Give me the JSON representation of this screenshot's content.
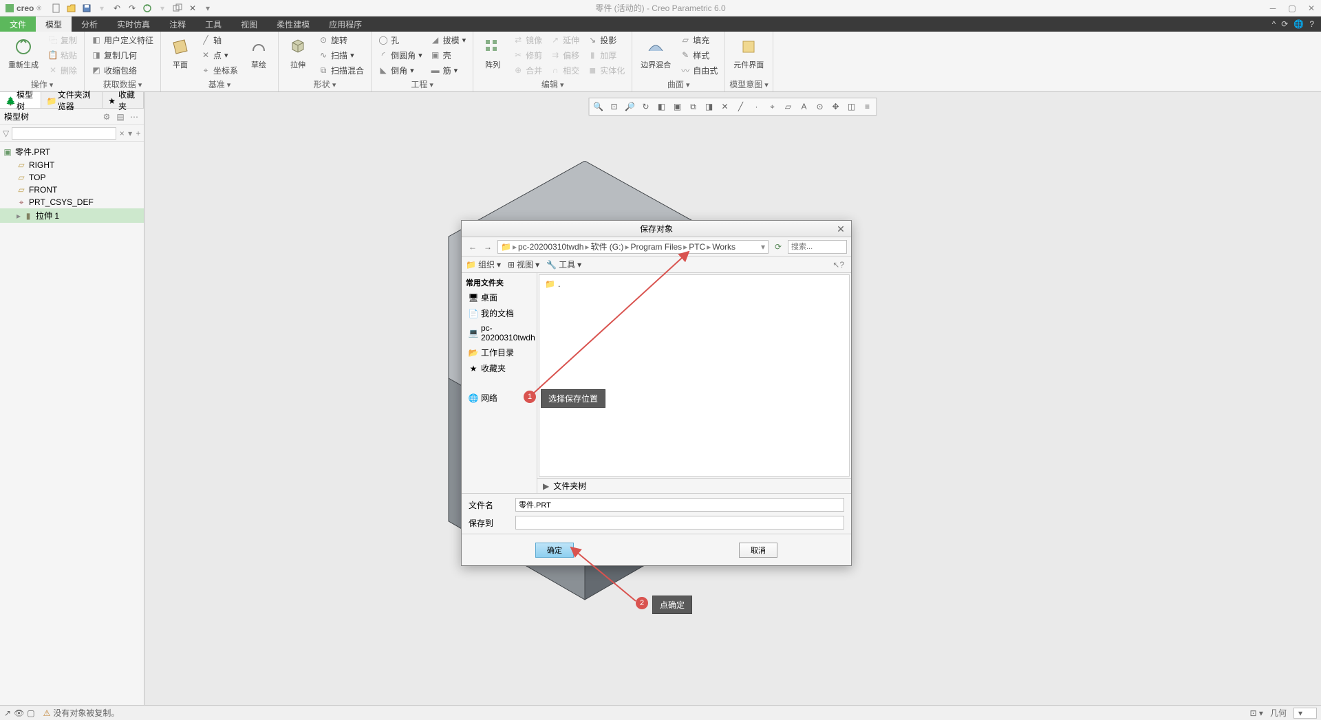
{
  "titlebar": {
    "logo_text": "creo",
    "title": "零件 (活动的) - Creo Parametric 6.0"
  },
  "menu_tabs": {
    "file": "文件",
    "model": "模型",
    "analysis": "分析",
    "realtime": "实时仿真",
    "annotate": "注释",
    "tools": "工具",
    "view": "视图",
    "flex": "柔性建模",
    "app": "应用程序"
  },
  "ribbon": {
    "regen": {
      "big": "重新生成",
      "copy": "复制",
      "paste": "粘贴",
      "delete": "删除",
      "group_label": "操作"
    },
    "getdata": {
      "udf": "用户定义特征",
      "copygeom": "复制几何",
      "shrink": "收缩包络",
      "group_label": "获取数据"
    },
    "datum": {
      "plane": "平面",
      "axis": "轴",
      "point": "点",
      "csys": "坐标系",
      "sketch": "草绘",
      "group_label": "基准"
    },
    "shape": {
      "extrude": "拉伸",
      "revolve": "旋转",
      "sweep": "扫描",
      "sweepblend": "扫描混合",
      "group_label": "形状"
    },
    "engineer": {
      "hole": "孔",
      "round": "倒圆角",
      "chamfer": "倒角",
      "draft": "拔模",
      "shell": "壳",
      "rib": "筋",
      "group_label": "工程"
    },
    "pattern": {
      "pattern": "阵列",
      "mirror": "镜像",
      "trim": "修剪",
      "merge": "合并",
      "extend": "延伸",
      "offset": "偏移",
      "thicken": "加厚",
      "intersect": "相交",
      "solidify": "实体化",
      "group_label": "编辑"
    },
    "surface": {
      "boundary": "边界混合",
      "fill": "填充",
      "style": "样式",
      "freeform": "自由式",
      "group_label": "曲面"
    },
    "compface": {
      "compface": "元件界面",
      "group_label": "模型意图"
    }
  },
  "left_panel": {
    "tab_model_tree": "模型树",
    "tab_folder": "文件夹浏览器",
    "tab_fav": "收藏夹",
    "tree_header": "模型树",
    "root": "零件.PRT",
    "node_right": "RIGHT",
    "node_top": "TOP",
    "node_front": "FRONT",
    "node_csys": "PRT_CSYS_DEF",
    "node_extrude": "拉伸 1"
  },
  "dialog": {
    "title": "保存对象",
    "breadcrumb": [
      "pc-20200310twdh",
      "软件 (G:)",
      "Program Files",
      "PTC",
      "Works"
    ],
    "search_placeholder": "搜索...",
    "toolbar2": {
      "org": "组织",
      "view": "视图",
      "tool": "工具"
    },
    "sidebar": {
      "header": "常用文件夹",
      "desktop": "桌面",
      "mydocs": "我的文档",
      "pc": "pc-20200310twdh",
      "workdir": "工作目录",
      "fav": "收藏夹",
      "network": "网络"
    },
    "file_dot": ".",
    "folder_tree": "文件夹树",
    "field_filename": "文件名",
    "field_saveto": "保存到",
    "filename_value": "零件.PRT",
    "saveto_value": "",
    "ok": "确定",
    "cancel": "取消"
  },
  "annotations": {
    "a1": "选择保存位置",
    "a2": "点确定"
  },
  "statusbar": {
    "msg": "没有对象被复制。",
    "right": "几何"
  }
}
